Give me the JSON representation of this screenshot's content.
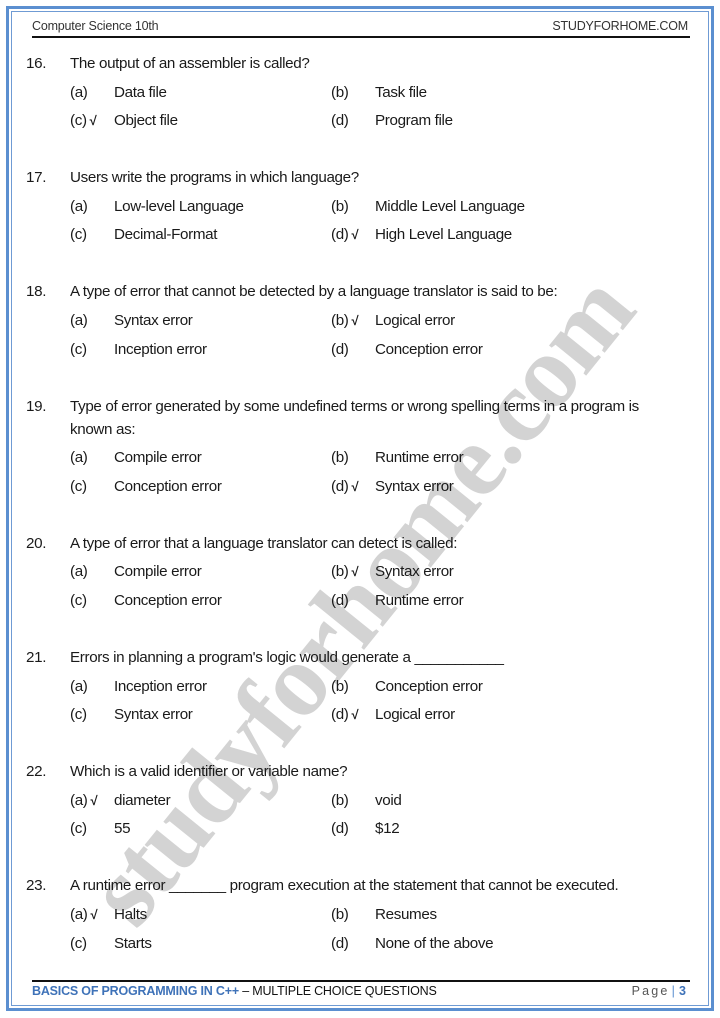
{
  "header": {
    "left": "Computer Science 10th",
    "right": "STUDYFORHOME.COM"
  },
  "watermark": "studyforhome.com",
  "footer": {
    "chapter": "BASICS OF PROGRAMMING IN C++",
    "separator": " – ",
    "section": "MULTIPLE CHOICE QUESTIONS",
    "page_label": "Page",
    "page_number": "3"
  },
  "check_symbol": "√",
  "questions": [
    {
      "number": "16.",
      "text": "The output of an assembler is called?",
      "options": [
        {
          "label": "(a)",
          "text": "Data file",
          "correct": false
        },
        {
          "label": "(b)",
          "text": "Task file",
          "correct": false
        },
        {
          "label": "(c)",
          "text": "Object file",
          "correct": true
        },
        {
          "label": "(d)",
          "text": "Program file",
          "correct": false
        }
      ]
    },
    {
      "number": "17.",
      "text": "Users write the programs in which language?",
      "options": [
        {
          "label": "(a)",
          "text": "Low-level Language",
          "correct": false
        },
        {
          "label": "(b)",
          "text": "Middle Level Language",
          "correct": false
        },
        {
          "label": "(c)",
          "text": "Decimal-Format",
          "correct": false
        },
        {
          "label": "(d)",
          "text": "High Level Language",
          "correct": true
        }
      ]
    },
    {
      "number": "18.",
      "text": "A type of error that cannot be detected by a language translator is said to be:",
      "options": [
        {
          "label": "(a)",
          "text": "Syntax error",
          "correct": false
        },
        {
          "label": "(b)",
          "text": "Logical error",
          "correct": true
        },
        {
          "label": "(c)",
          "text": "Inception error",
          "correct": false
        },
        {
          "label": "(d)",
          "text": "Conception error",
          "correct": false
        }
      ]
    },
    {
      "number": "19.",
      "text": "Type of error generated by some undefined terms or wrong spelling terms in a program is",
      "text_line2": "known as:",
      "options": [
        {
          "label": "(a)",
          "text": "Compile error",
          "correct": false
        },
        {
          "label": "(b)",
          "text": "Runtime error",
          "correct": false
        },
        {
          "label": "(c)",
          "text": "Conception error",
          "correct": false
        },
        {
          "label": "(d)",
          "text": "Syntax error",
          "correct": true
        }
      ]
    },
    {
      "number": "20.",
      "text": "A type of error that a language translator can detect is called:",
      "options": [
        {
          "label": "(a)",
          "text": "Compile error",
          "correct": false
        },
        {
          "label": "(b)",
          "text": "Syntax error",
          "correct": true
        },
        {
          "label": "(c)",
          "text": "Conception error",
          "correct": false
        },
        {
          "label": "(d)",
          "text": "Runtime error",
          "correct": false
        }
      ]
    },
    {
      "number": "21.",
      "text": "Errors in planning a program's logic would generate a ___________",
      "options": [
        {
          "label": "(a)",
          "text": "Inception error",
          "correct": false
        },
        {
          "label": "(b)",
          "text": "Conception error",
          "correct": false
        },
        {
          "label": "(c)",
          "text": "Syntax error",
          "correct": false
        },
        {
          "label": "(d)",
          "text": "Logical error",
          "correct": true
        }
      ]
    },
    {
      "number": "22.",
      "text": "Which is a valid identifier or variable name?",
      "options": [
        {
          "label": "(a)",
          "text": "diameter",
          "correct": true
        },
        {
          "label": "(b)",
          "text": "void",
          "correct": false
        },
        {
          "label": "(c)",
          "text": "55",
          "correct": false
        },
        {
          "label": "(d)",
          "text": "$12",
          "correct": false
        }
      ]
    },
    {
      "number": "23.",
      "text": "A runtime error _______ program execution at the statement that cannot be executed.",
      "options": [
        {
          "label": "(a)",
          "text": "Halts",
          "correct": true
        },
        {
          "label": "(b)",
          "text": "Resumes",
          "correct": false
        },
        {
          "label": "(c)",
          "text": "Starts",
          "correct": false
        },
        {
          "label": "(d)",
          "text": "None of the above",
          "correct": false
        }
      ]
    }
  ]
}
